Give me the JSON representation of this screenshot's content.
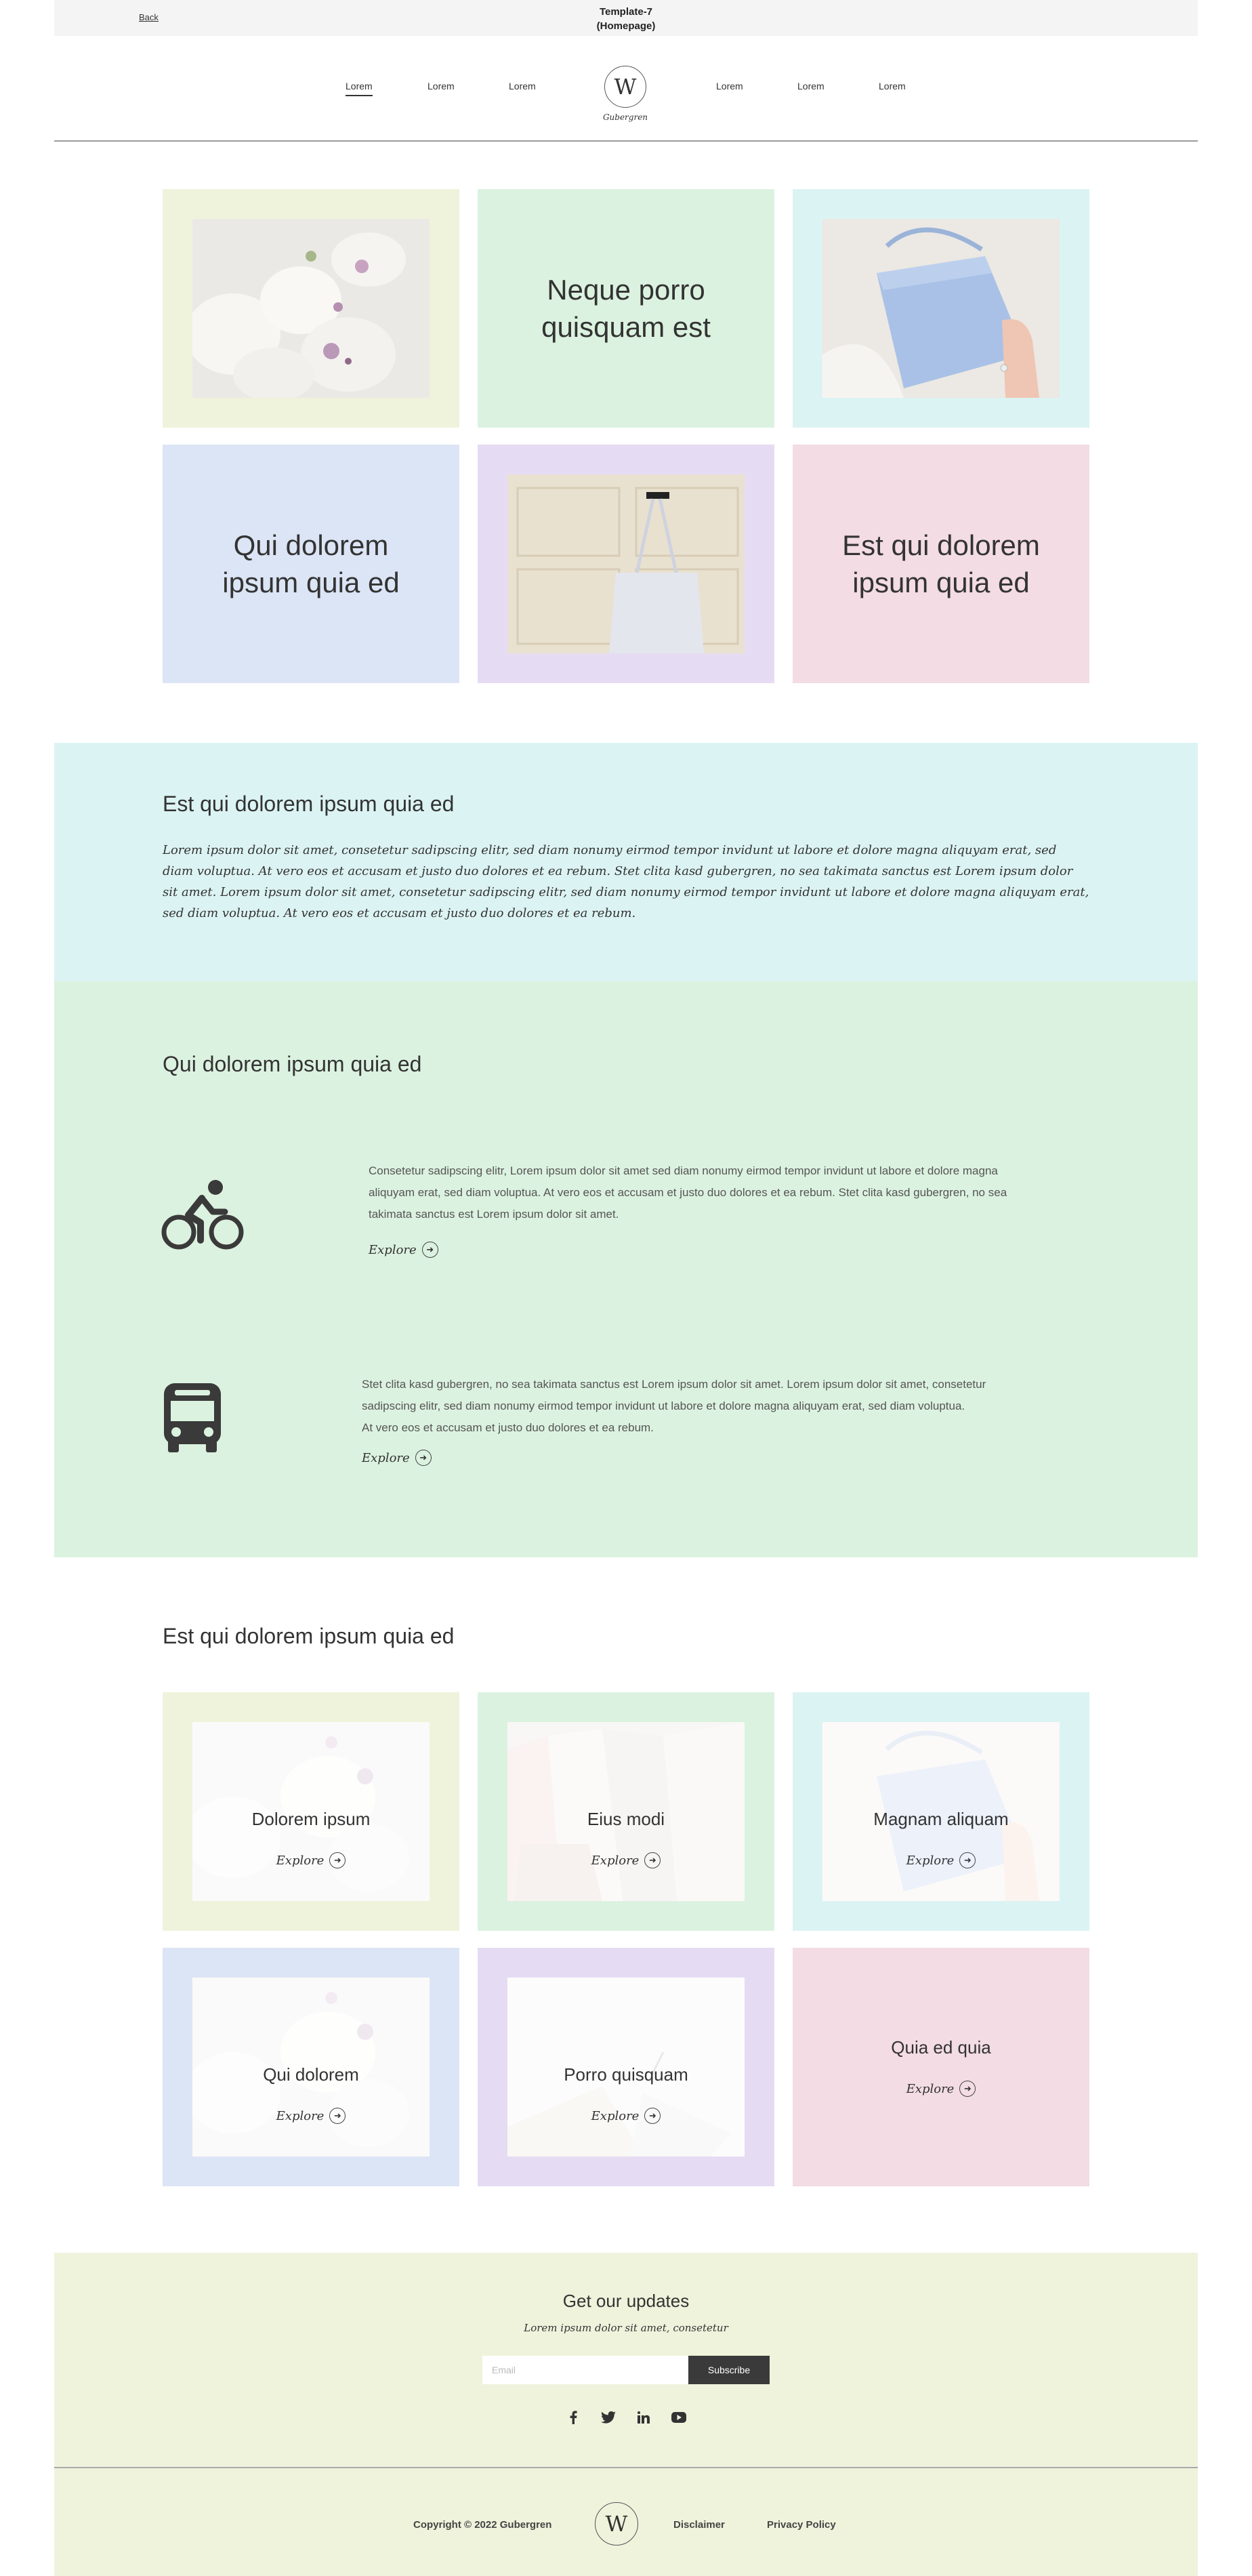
{
  "topbar": {
    "back_label": "Back",
    "title_line1": "Template-7",
    "title_line2": "(Homepage)"
  },
  "nav": {
    "items_left": [
      "Lorem",
      "Lorem",
      "Lorem"
    ],
    "items_right": [
      "Lorem",
      "Lorem",
      "Lorem"
    ],
    "logo_letter": "W",
    "logo_name": "Gubergren"
  },
  "hero": {
    "tiles": [
      {
        "kind": "image",
        "image": "white orchid flowers photo",
        "bg": "#eff3dc"
      },
      {
        "kind": "text",
        "text_line1": "Neque porro",
        "text_line2": "quisquam est",
        "bg": "#dcf2e0"
      },
      {
        "kind": "image",
        "image": "blue handbag held in hand photo",
        "bg": "#dcf3f3"
      },
      {
        "kind": "text",
        "text_line1": "Qui dolorem",
        "text_line2": "ipsum quia ed",
        "bg": "#dce5f5"
      },
      {
        "kind": "image",
        "image": "white tote bag hanging on door photo",
        "bg": "#e5dcf3"
      },
      {
        "kind": "text",
        "text_line1": "Est qui dolorem",
        "text_line2": "ipsum quia ed",
        "bg": "#f3dce4"
      }
    ]
  },
  "intro": {
    "heading": "Est qui dolorem ipsum quia ed",
    "body": "Lorem ipsum dolor sit amet, consetetur sadipscing elitr, sed diam nonumy eirmod tempor invidunt ut labore et dolore magna aliquyam erat, sed diam voluptua. At vero eos et accusam et justo duo dolores et ea rebum. Stet clita kasd gubergren, no sea takimata sanctus est Lorem ipsum dolor sit amet. Lorem ipsum dolor sit amet, consetetur sadipscing elitr, sed diam nonumy eirmod tempor invidunt ut labore et dolore magna aliquyam erat, sed diam voluptua. At vero eos et accusam et justo duo dolores et ea rebum."
  },
  "features": {
    "heading": "Qui dolorem ipsum quia ed",
    "items": [
      {
        "icon": "bicycle-icon",
        "text_line1": "Consetetur sadipscing elitr, Lorem ipsum dolor sit amet sed diam nonumy eirmod tempor invidunt ut labore et dolore magna",
        "text_line2": "aliquyam erat, sed diam voluptua. At vero eos et accusam et justo duo dolores et ea rebum. Stet clita kasd gubergren, no sea",
        "text_line3": "takimata sanctus est Lorem ipsum dolor sit amet.",
        "explore": "Explore"
      },
      {
        "icon": "bus-icon",
        "text_line1": "Stet clita kasd gubergren, no sea takimata sanctus est Lorem ipsum dolor sit amet. Lorem ipsum dolor sit amet, consetetur",
        "text_line2": "sadipscing elitr, sed diam nonumy eirmod tempor invidunt ut labore et dolore magna aliquyam erat, sed diam voluptua.",
        "text_line3": "At vero eos et accusam et justo duo dolores et ea rebum.",
        "explore": "Explore"
      }
    ]
  },
  "cards": {
    "heading": "Est qui dolorem ipsum quia ed",
    "items": [
      {
        "label": "Dolorem ipsum",
        "explore": "Explore",
        "bg": "#eff3dc",
        "image": "white orchid flowers photo"
      },
      {
        "label": "Eius modi",
        "explore": "Explore",
        "bg": "#dcf2e0",
        "image": "knitwear on hangers photo"
      },
      {
        "label": "Magnam aliquam",
        "explore": "Explore",
        "bg": "#dcf3f3",
        "image": "blue handbag photo"
      },
      {
        "label": "Qui dolorem",
        "explore": "Explore",
        "bg": "#dce5f5",
        "image": "white orchid flowers photo"
      },
      {
        "label": "Porro quisquam",
        "explore": "Explore",
        "bg": "#e5dcf3",
        "image": "notebook and pen photo"
      },
      {
        "label": "Quia ed quia",
        "explore": "Explore",
        "bg": "#f3dce4",
        "image": ""
      }
    ]
  },
  "newsletter": {
    "heading": "Get our updates",
    "subheading": "Lorem ipsum dolor sit amet, consetetur",
    "email_placeholder": "Email",
    "subscribe_label": "Subscribe",
    "social_icons": [
      "facebook-icon",
      "twitter-icon",
      "linkedin-icon",
      "youtube-icon"
    ]
  },
  "footer": {
    "copyright": "Copyright © 2022 Gubergren",
    "logo_letter": "W",
    "links": [
      "Disclaimer",
      "Privacy Policy"
    ]
  }
}
